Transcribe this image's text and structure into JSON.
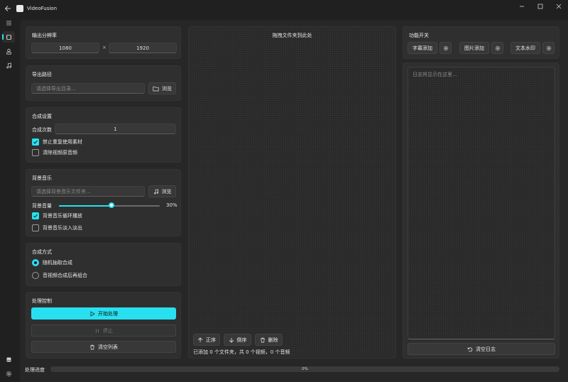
{
  "window": {
    "title": "VideoFusion",
    "controls": [
      "minimize-icon",
      "maximize-icon",
      "close-icon"
    ]
  },
  "nav": {
    "items": [
      "menu-icon",
      "video-clip-icon",
      "person-icon",
      "music-note-icon"
    ],
    "bottom": [
      "storage-icon",
      "gear-icon"
    ],
    "active_index": 1
  },
  "resolution": {
    "title": "输出分辨率",
    "width": "1080",
    "separator": "×",
    "height": "1920"
  },
  "export": {
    "title": "导出路径",
    "placeholder": "请选择导出目录...",
    "browse_label": "浏览"
  },
  "synthesis": {
    "title": "合成设置",
    "count_label": "合成次数",
    "count_value": "1",
    "no_reuse_label": "禁止重复使用素材",
    "no_reuse_checked": true,
    "clear_audio_label": "清除视频原音频",
    "clear_audio_checked": false
  },
  "bgm": {
    "title": "背景音乐",
    "placeholder": "请选择背景音乐文件夹...",
    "browse_label": "浏览",
    "volume_label": "背景音量",
    "volume_value": 30,
    "volume_text": "30%",
    "loop_label": "背景音乐循环播放",
    "loop_checked": true,
    "fade_label": "背景音乐淡入淡出",
    "fade_checked": false
  },
  "method": {
    "title": "合成方式",
    "option_random": "随机抽取合成",
    "option_combine": "音视频合成后再组合",
    "selected": "random"
  },
  "control": {
    "title": "处理控制",
    "start_label": "开始处理",
    "stop_label": "停止",
    "clear_label": "清空列表"
  },
  "drop": {
    "title": "拖拽文件夹到此处",
    "asc_label": "正序",
    "desc_label": "倒序",
    "delete_label": "删除",
    "status": "已添加 0 个文件夹，共 0 个视频，0 个音频"
  },
  "features": {
    "title": "功能开关",
    "subtitle_label": "字幕添加",
    "image_label": "图片添加",
    "watermark_label": "文本水印"
  },
  "log": {
    "placeholder": "日志将显示在这里...",
    "clear_label": "清空日志"
  },
  "progress": {
    "label": "处理进度",
    "value": 0,
    "text": "0%"
  },
  "colors": {
    "accent": "#28e0f0",
    "background": "#202020",
    "card": "#2f2f2f"
  }
}
